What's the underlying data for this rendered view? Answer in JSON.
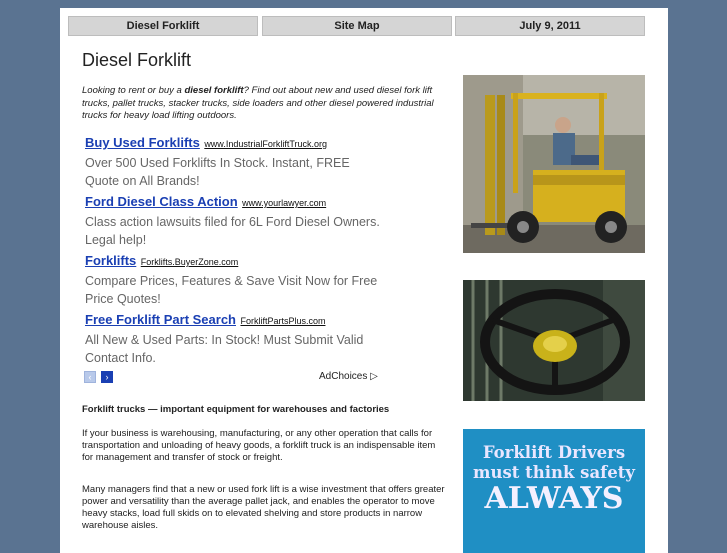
{
  "topbar": {
    "tab1": "Diesel Forklift",
    "tab2": "Site Map",
    "tab3": "July 9, 2011"
  },
  "page_title": "Diesel Forklift",
  "intro": {
    "before": "Looking to rent or buy a ",
    "bold": "diesel forklift",
    "after": "? Find out about new and used diesel fork lift trucks, pallet trucks, stacker trucks, side loaders and other diesel powered industrial trucks for heavy load lifting outdoors."
  },
  "ads": [
    {
      "title": "Buy Used Forklifts",
      "url": "www.IndustrialForkliftTruck.org",
      "desc": "Over 500 Used Forklifts In Stock. Instant, FREE Quote on All Brands!"
    },
    {
      "title": "Ford Diesel Class Action",
      "url": "www.yourlawyer.com",
      "desc": "Class action lawsuits filed for 6L Ford Diesel Owners. Legal help!"
    },
    {
      "title": "Forklifts",
      "url": "Forklifts.BuyerZone.com",
      "desc": "Compare Prices, Features & Save Visit Now for Free Price Quotes!"
    },
    {
      "title": "Free Forklift Part Search",
      "url": "ForkliftPartsPlus.com",
      "desc": "All New & Used Parts: In Stock! Must Submit Valid Contact Info."
    }
  ],
  "adchoices": "AdChoices ▷",
  "nav": {
    "prev": "‹",
    "next": "›"
  },
  "section_heading": "Forklift trucks — important equipment for warehouses and factories",
  "paragraphs": [
    "If your business is warehousing, manufacturing, or any other operation that calls for transportation and unloading of heavy goods, a forklift truck is an indispensable item for management and transfer of stock or freight.",
    "Many managers find that a new or used fork lift is a wise investment that offers greater power and versatility than the average pallet jack, and enables the operator to move heavy stacks, load full skids on to elevated shelving and store products in narrow warehouse aisles."
  ],
  "sign": {
    "line1": "Forklift Drivers",
    "line2": "must think safety",
    "line3": "ALWAYS"
  },
  "colors": {
    "background": "#5a7391",
    "link": "#1a3fb3",
    "ad_text": "#666666",
    "sign_blue": "#1f8fc4"
  },
  "icons": {
    "prev": "chevron-left-icon",
    "next": "chevron-right-icon",
    "adchoices": "adchoices-triangle-icon"
  }
}
